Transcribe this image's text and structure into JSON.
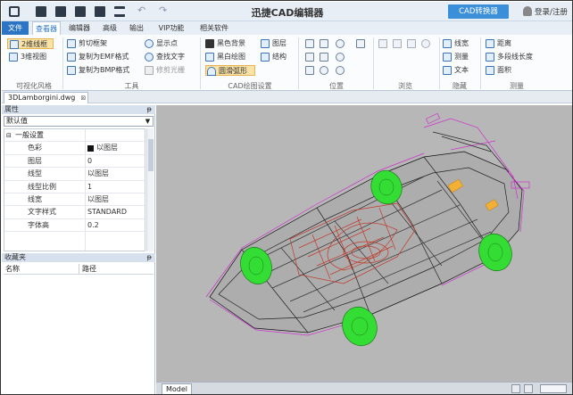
{
  "app": {
    "title": "迅捷CAD编辑器",
    "convert_button": "CAD转换器",
    "login": "登录/注册"
  },
  "tabs": [
    "文件",
    "查看器",
    "编辑器",
    "高级",
    "输出",
    "VIP功能",
    "相关软件"
  ],
  "ribbon": {
    "visual_style": {
      "label": "可视化风格",
      "items": [
        "2维线框",
        "3维视图"
      ]
    },
    "tools": {
      "label": "工具",
      "items": [
        "剪切框架",
        "复制为EMF格式",
        "复制为BMP格式",
        "显示点",
        "查找文字",
        "修剪光栅"
      ]
    },
    "cad_settings": {
      "label": "CAD绘图设置",
      "items": [
        "黑色背景",
        "黑白绘图",
        "圆滑弧形",
        "图层",
        "结构"
      ]
    },
    "position": {
      "label": "位置"
    },
    "browse": {
      "label": "浏览"
    },
    "hide": {
      "label": "隐藏",
      "items": [
        "线宽",
        "测量",
        "文本"
      ]
    },
    "measure": {
      "label": "测量",
      "items": [
        "距离",
        "多段线长度",
        "面积"
      ]
    }
  },
  "document_tab": "3DLamborgini.dwg",
  "properties": {
    "header": "属性",
    "selection": "默认值",
    "category": "一般设置",
    "rows": [
      {
        "name": "色彩",
        "value": "以图层"
      },
      {
        "name": "图层",
        "value": "0"
      },
      {
        "name": "线型",
        "value": "以图层"
      },
      {
        "name": "线型比例",
        "value": "1"
      },
      {
        "name": "线宽",
        "value": "以图层"
      },
      {
        "name": "文字样式",
        "value": "STANDARD"
      },
      {
        "name": "字体高",
        "value": "0.2"
      }
    ]
  },
  "favorites": {
    "header": "收藏夹",
    "col_name": "名称",
    "col_path": "路径"
  },
  "model_tab": "Model",
  "colors": {
    "accent": "#2b75c4",
    "canvas": "#b7b7b7",
    "wheel": "#33dd33",
    "wire_red": "#c0392b",
    "wire_magenta": "#cc33cc"
  }
}
